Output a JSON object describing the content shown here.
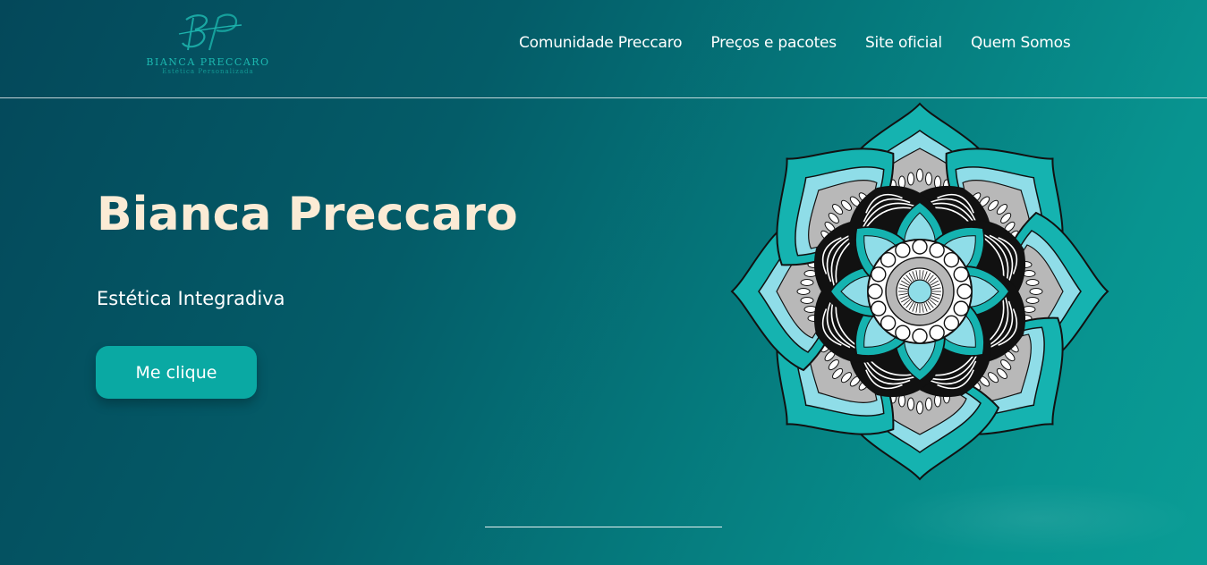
{
  "logo": {
    "monogram": "BP",
    "name": "BIANCA PRECCARO",
    "tagline": "Estética Personalizada"
  },
  "nav": {
    "items": [
      {
        "label": "Comunidade Preccaro"
      },
      {
        "label": "Preços e pacotes"
      },
      {
        "label": "Site oficial"
      },
      {
        "label": "Quem Somos"
      }
    ]
  },
  "hero": {
    "title": "Bianca Preccaro",
    "subtitle": "Estética Integradiva",
    "cta_label": "Me clique"
  },
  "mandala": {
    "icon": "mandala-illustration",
    "colors": {
      "teal": "#15b3b0",
      "light_blue": "#8fdde8",
      "gray": "#b8b8b8",
      "black": "#111111",
      "white": "#ffffff"
    }
  },
  "colors": {
    "title": "#fbebd5",
    "button": "#0aa9a3",
    "background_start": "#04485a",
    "background_end": "#0a9d96"
  }
}
